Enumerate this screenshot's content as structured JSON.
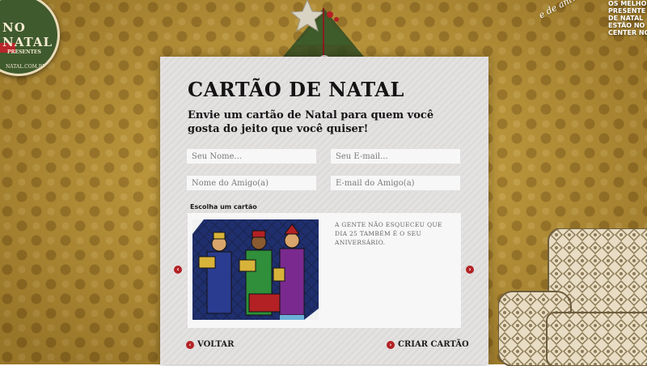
{
  "logo": {
    "brand_line1": "NO NATAL",
    "brand_line2": "PRESENTES",
    "url": "NATAL.COM.BR"
  },
  "promo": {
    "script_text": "e de aniversário",
    "lines": [
      "OS MELHOR",
      "PRESENTE",
      "DE NATAL",
      "ESTÃO NO",
      "CENTER NO"
    ]
  },
  "card_form": {
    "title": "CARTÃO DE NATAL",
    "subtitle": "Envie um cartão de Natal para quem você gosta do jeito que você quiser!",
    "fields": {
      "name_placeholder": "Seu Nome...",
      "email_placeholder": "Seu E-mail...",
      "friend_name_placeholder": "Nome do Amigo(a)",
      "friend_email_placeholder": "E-mail do Amigo(a)"
    },
    "choose_label": "Escolha um cartão",
    "selected_card": {
      "image_icon": "three-wise-men-stained-glass-icon",
      "message": "A GENTE NÃO ESQUECEU QUE DIA 25 TAMBÉM É O SEU ANIVERSÁRIO."
    },
    "prev_icon": "chevron-left-icon",
    "next_icon": "chevron-right-icon",
    "back_label": "VOLTAR",
    "create_label": "CRIAR CARTÃO"
  },
  "colors": {
    "accent_red": "#b32124",
    "wallpaper": "#c9a23c",
    "panel": "#e4e1e1"
  }
}
